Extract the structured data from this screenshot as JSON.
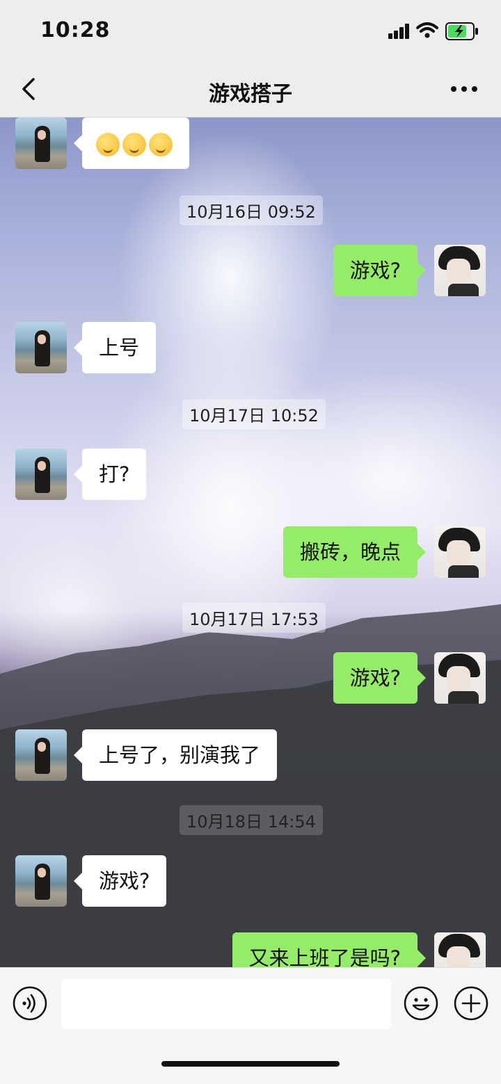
{
  "status": {
    "time": "10:28"
  },
  "nav": {
    "title": "游戏搭子"
  },
  "messages": [
    {
      "side": "in",
      "text": ""
    },
    {
      "stamp": "10月16日 09:52"
    },
    {
      "side": "out",
      "text": "游戏?"
    },
    {
      "side": "in",
      "text": "上号"
    },
    {
      "stamp": "10月17日 10:52"
    },
    {
      "side": "in",
      "text": "打?"
    },
    {
      "side": "out",
      "text": "搬砖，晚点"
    },
    {
      "stamp": "10月17日 17:53"
    },
    {
      "side": "out",
      "text": "游戏?"
    },
    {
      "side": "in",
      "text": "上号了，别演我了"
    },
    {
      "stamp": "10月18日 14:54"
    },
    {
      "side": "in",
      "text": "游戏?"
    },
    {
      "side": "out",
      "text": "又来上班了是吗?"
    }
  ],
  "icons": {
    "back": "chevron-left-icon",
    "more": "more-dots-icon",
    "voice": "voice-icon",
    "emoji": "emoji-icon",
    "plus": "plus-icon"
  },
  "colors": {
    "outgoing_bubble": "#95ec69",
    "incoming_bubble": "#ffffff"
  }
}
